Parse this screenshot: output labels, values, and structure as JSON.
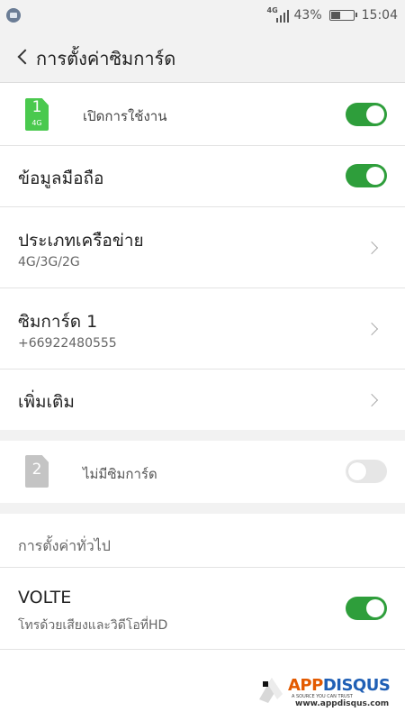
{
  "status_bar": {
    "network_type": "4G",
    "battery_percent": "43%",
    "battery_level": 0.43,
    "time": "15:04"
  },
  "header": {
    "title": "การตั้งค่าซิมการ์ด"
  },
  "sim1": {
    "number": "1",
    "network": "4G",
    "label": "เปิดการใช้งาน",
    "enabled": true
  },
  "mobile_data": {
    "title": "ข้อมูลมือถือ",
    "enabled": true
  },
  "network_type": {
    "title": "ประเภทเครือข่าย",
    "value": "4G/3G/2G"
  },
  "sim_card": {
    "title": "ซิมการ์ด 1",
    "phone": "+66922480555"
  },
  "more": {
    "title": "เพิ่มเติม"
  },
  "sim2": {
    "number": "2",
    "label": "ไม่มีซิมการ์ด",
    "enabled": false
  },
  "general": {
    "section_title": "การตั้งค่าทั่วไป"
  },
  "volte": {
    "title": "VOLTE",
    "subtitle": "โทรด้วยเสียงและวิดีโอที่HD",
    "enabled": true
  },
  "watermark": {
    "brand_app": "APP",
    "brand_disqus": "DISQUS",
    "tagline": "A SOURCE YOU CAN TRUST",
    "url": "www.appdisqus.com"
  },
  "colors": {
    "toggle_on": "#2e9e3b",
    "sim_active": "#4ac94e",
    "sim_inactive": "#c4c4c4"
  }
}
